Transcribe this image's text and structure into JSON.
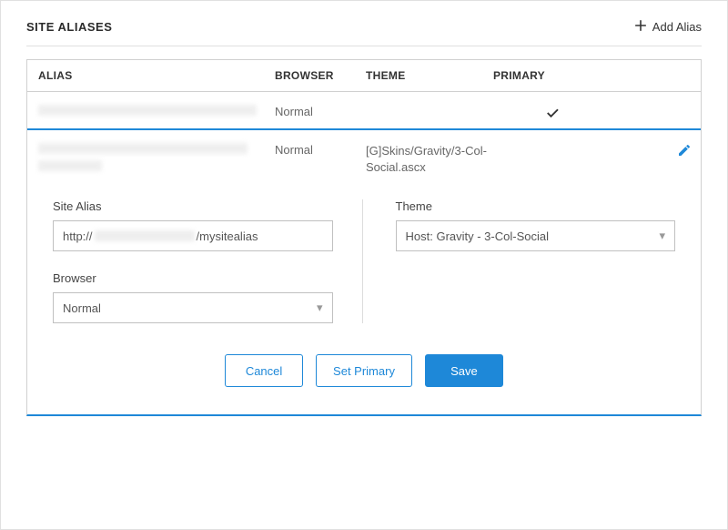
{
  "header": {
    "title": "SITE ALIASES",
    "add_label": "Add Alias"
  },
  "columns": {
    "alias": "ALIAS",
    "browser": "BROWSER",
    "theme": "THEME",
    "primary": "PRIMARY"
  },
  "rows": [
    {
      "alias": "",
      "browser": "Normal",
      "theme": "",
      "primary": true
    },
    {
      "alias": "",
      "browser": "Normal",
      "theme": "[G]Skins/Gravity/3-Col-Social.ascx",
      "primary": false
    }
  ],
  "edit": {
    "site_alias_label": "Site Alias",
    "site_alias_prefix": "http://",
    "site_alias_suffix": "/mysitealias",
    "browser_label": "Browser",
    "browser_value": "Normal",
    "theme_label": "Theme",
    "theme_value": "Host: Gravity - 3-Col-Social"
  },
  "buttons": {
    "cancel": "Cancel",
    "set_primary": "Set Primary",
    "save": "Save"
  },
  "colors": {
    "accent": "#1e88d8"
  }
}
